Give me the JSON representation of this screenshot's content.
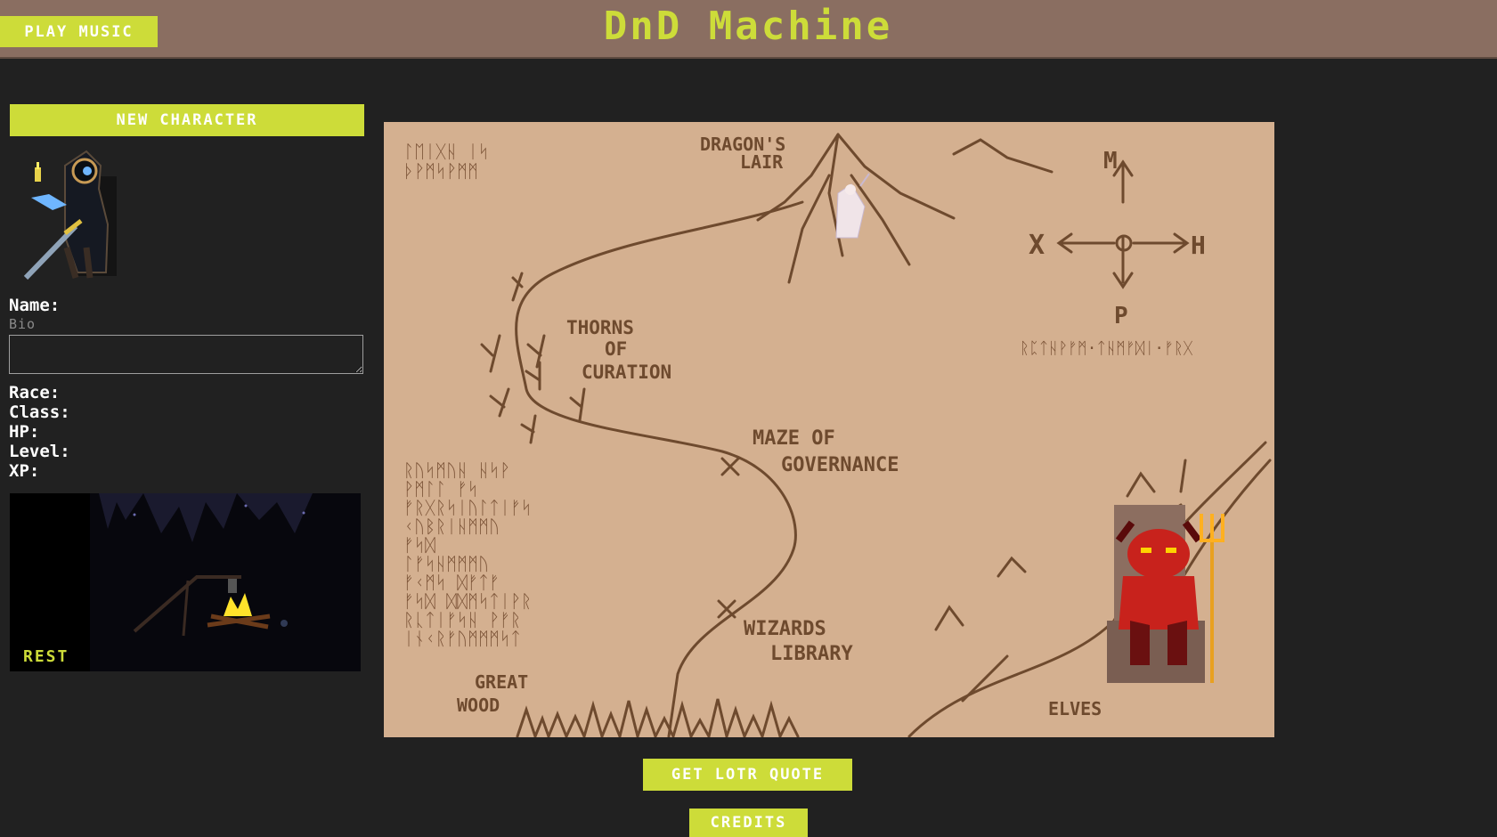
{
  "header": {
    "play_music_label": "PLAY MUSIC",
    "title": "DnD Machine"
  },
  "sidebar": {
    "new_character_label": "NEW CHARACTER",
    "name_label": "Name:",
    "bio_placeholder": "Bio",
    "bio_value": "",
    "race_label": "Race:",
    "class_label": "Class:",
    "hp_label": "HP:",
    "level_label": "Level:",
    "xp_label": "XP:",
    "rest_label": "REST"
  },
  "map": {
    "labels": {
      "dragons_lair_1": "DRAGON'S",
      "dragons_lair_2": "LAIR",
      "thorns_1": "THORNS",
      "thorns_2": "OF",
      "thorns_3": "CURATION",
      "maze_1": "MAZE OF",
      "maze_2": "GOVERNANCE",
      "wizards_1": "WIZARDS",
      "wizards_2": "LIBRARY",
      "great_wood_1": "GREAT",
      "great_wood_2": "WOOD",
      "elves": "ELVES",
      "compass_n": "M",
      "compass_s": "P",
      "compass_w": "X",
      "compass_e": "H"
    },
    "runes": {
      "top_left_1": "ᛚᛖᛁᚷᚺ ᛁᛋ",
      "top_left_2": "ᚦᚹᛗᛋᚹᛗᛗ",
      "compass_line": "ᚱᛈᛏᚺᚹᚠᛗ·ᛏᚺᛗᚠᛞᛁ·ᚠᚱᚷ",
      "block_1": "ᚱᚢᛋᛗᚢᚺ ᚺᛋᚹ",
      "block_2": "ᚹᛗᛚᛚ ᚠᛋ",
      "block_3": "ᚠᚱᚷᚱᛋᛁᚢᛚᛏᛁᚠᛋ",
      "block_4": "ᚲᚢᛒᚱᛁᚺᛗᛗᚢ",
      "block_5": "ᚠᛋᛞ",
      "block_6": "ᛚᚠᛋᚺᛗᛗᛗᚢ",
      "block_7": "ᚠᚲᛗᛋ ᛞᚠᛏᚠ",
      "block_8": "ᚠᛋᛞ ᛞᛞᛗᛋᛏᛁᚹᚱ",
      "block_9": "ᚱᚳᛏᛁᚠᛋᚺ ᚹᚠᚱ",
      "block_10": "ᛁᚾᚲᚱᚠᚢᛗᛗᛗᛋᛏ"
    }
  },
  "footer": {
    "lotr_label": "GET LOTR QUOTE",
    "credits_label": "CREDITS"
  },
  "colors": {
    "accent": "#cddc39",
    "header_bg": "#8a6e61",
    "page_bg": "#212121",
    "map_bg": "#d4b090",
    "ink": "#6e4a2e"
  },
  "icons": {
    "hero": "hooded-rogue-icon",
    "campfire": "campfire-icon",
    "dragon_wizard": "wizard-sprite-icon",
    "devil": "devil-on-throne-icon"
  }
}
